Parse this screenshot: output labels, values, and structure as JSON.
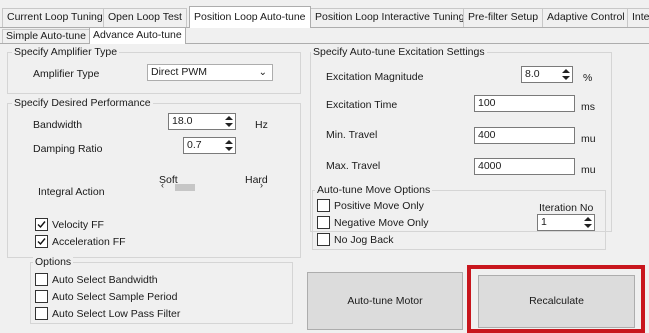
{
  "tabs": [
    "Current Loop Tuning",
    "Open Loop Test",
    "Position Loop Auto-tune",
    "Position Loop Interactive Tuning",
    "Pre-filter Setup",
    "Adaptive Control",
    "Inte"
  ],
  "subtabs": [
    "Simple Auto-tune",
    "Advance Auto-tune"
  ],
  "amplifier": {
    "group_title": "Specify Amplifier Type",
    "type_label": "Amplifier Type",
    "type_value": "Direct PWM"
  },
  "performance": {
    "group_title": "Specify Desired Performance",
    "bandwidth_label": "Bandwidth",
    "bandwidth_value": "18.0",
    "bandwidth_unit": "Hz",
    "damping_label": "Damping Ratio",
    "damping_value": "0.7",
    "integral_label": "Integral Action",
    "soft_label": "Soft",
    "hard_label": "Hard",
    "integral_level": 0.1,
    "velocity_ff_label": "Velocity FF",
    "velocity_ff_checked": true,
    "accel_ff_label": "Acceleration FF",
    "accel_ff_checked": true
  },
  "options": {
    "group_title": "Options",
    "items": [
      {
        "label": "Auto Select Bandwidth",
        "checked": false
      },
      {
        "label": "Auto Select Sample Period",
        "checked": false
      },
      {
        "label": "Auto Select Low Pass Filter",
        "checked": false
      }
    ]
  },
  "excitation": {
    "group_title": "Specify Auto-tune Excitation Settings",
    "magnitude_label": "Excitation Magnitude",
    "magnitude_value": "8.0",
    "magnitude_unit": "%",
    "time_label": "Excitation Time",
    "time_value": "100",
    "time_unit": "ms",
    "min_travel_label": "Min. Travel",
    "min_travel_value": "400",
    "min_travel_unit": "mu",
    "max_travel_label": "Max. Travel",
    "max_travel_value": "4000",
    "max_travel_unit": "mu"
  },
  "move_options": {
    "group_title": "Auto-tune Move Options",
    "positive_label": "Positive Move Only",
    "negative_label": "Negative Move Only",
    "nojog_label": "No Jog Back",
    "iteration_label": "Iteration No",
    "iteration_value": "1"
  },
  "buttons": {
    "autotune_motor": "Auto-tune Motor",
    "recalculate": "Recalculate"
  },
  "colors": {
    "highlight": "#c8161d",
    "window_bg": "#f0f0f0"
  }
}
